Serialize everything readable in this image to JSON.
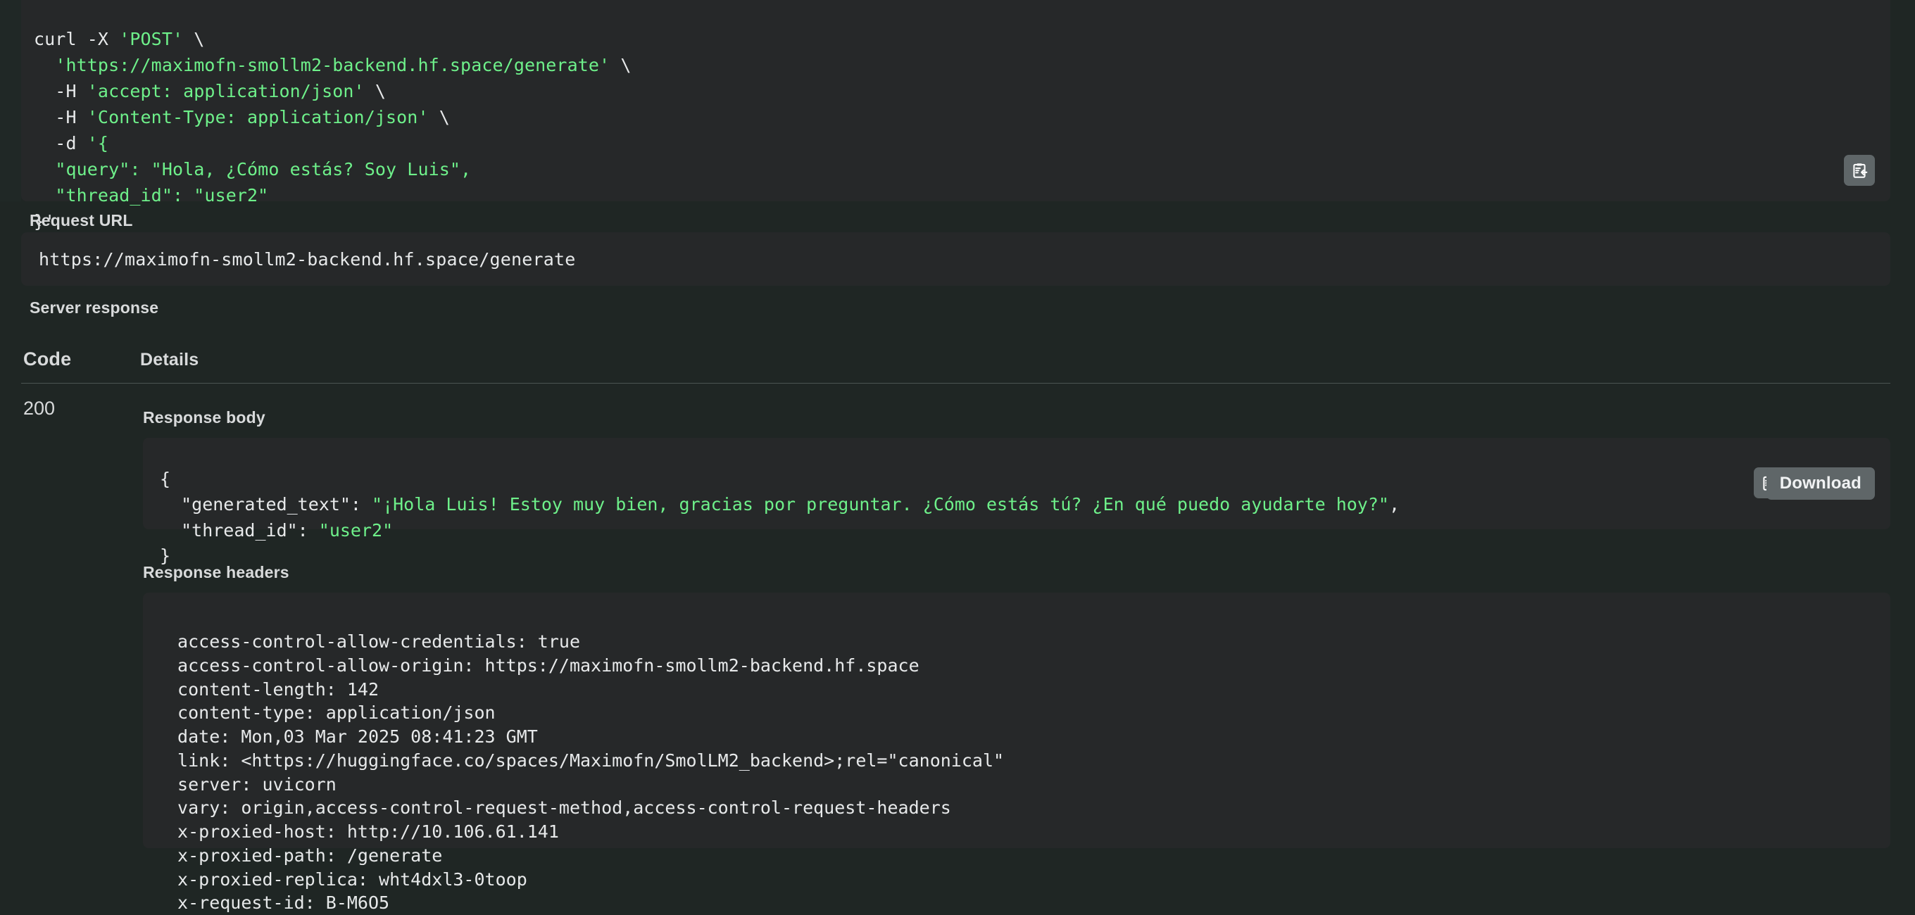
{
  "curl": {
    "lines": [
      [
        {
          "t": "curl -X ",
          "c": "w"
        },
        {
          "t": "'POST' ",
          "c": "g"
        },
        {
          "t": "\\",
          "c": "w"
        }
      ],
      [
        {
          "t": "  ",
          "c": "w"
        },
        {
          "t": "'https://maximofn-smollm2-backend.hf.space/generate' ",
          "c": "g"
        },
        {
          "t": "\\",
          "c": "w"
        }
      ],
      [
        {
          "t": "  -H ",
          "c": "w"
        },
        {
          "t": "'accept: application/json' ",
          "c": "g"
        },
        {
          "t": "\\",
          "c": "w"
        }
      ],
      [
        {
          "t": "  -H ",
          "c": "w"
        },
        {
          "t": "'Content-Type: application/json' ",
          "c": "g"
        },
        {
          "t": "\\",
          "c": "w"
        }
      ],
      [
        {
          "t": "  -d ",
          "c": "w"
        },
        {
          "t": "'{",
          "c": "g"
        }
      ],
      [
        {
          "t": "  ",
          "c": "g"
        },
        {
          "t": "\"query\": \"Hola, ¿Cómo estás? Soy Luis\",",
          "c": "g"
        }
      ],
      [
        {
          "t": "  ",
          "c": "g"
        },
        {
          "t": "\"thread_id\": \"user2\"",
          "c": "g"
        }
      ],
      [
        {
          "t": "}'",
          "c": "w"
        }
      ]
    ],
    "copy_title": "Copy to clipboard"
  },
  "request_url": {
    "label": "Request URL",
    "value": "https://maximofn-smollm2-backend.hf.space/generate"
  },
  "server_response": {
    "label": "Server response",
    "columns": {
      "code": "Code",
      "details": "Details"
    },
    "row": {
      "code": "200",
      "response_body_label": "Response body",
      "response_headers_label": "Response headers",
      "download_label": "Download",
      "copy_title": "Copy to clipboard"
    }
  },
  "response_body": {
    "lines": [
      [
        {
          "t": "{",
          "c": "w"
        }
      ],
      [
        {
          "t": "  \"generated_text\": ",
          "c": "w"
        },
        {
          "t": "\"¡Hola Luis! Estoy muy bien, gracias por preguntar. ¿Cómo estás tú? ¿En qué puedo ayudarte hoy?\"",
          "c": "g"
        },
        {
          "t": ",",
          "c": "w"
        }
      ],
      [
        {
          "t": "  \"thread_id\": ",
          "c": "w"
        },
        {
          "t": "\"user2\"",
          "c": "g"
        }
      ],
      [
        {
          "t": "}",
          "c": "w"
        }
      ]
    ]
  },
  "response_headers": {
    "lines": [
      " access-control-allow-credentials: true ",
      " access-control-allow-origin: https://maximofn-smollm2-backend.hf.space ",
      " content-length: 142 ",
      " content-type: application/json ",
      " date: Mon,03 Mar 2025 08:41:23 GMT ",
      " link: <https://huggingface.co/spaces/Maximofn/SmolLM2_backend>;rel=\"canonical\" ",
      " server: uvicorn ",
      " vary: origin,access-control-request-method,access-control-request-headers ",
      " x-proxied-host: http://10.106.61.141 ",
      " x-proxied-path: /generate ",
      " x-proxied-replica: wht4dxl3-0toop ",
      " x-request-id: B-M6O5 "
    ]
  },
  "colors": {
    "page_bg": "#1f2624",
    "block_bg": "#262829",
    "string_green": "#6ef08a",
    "text_light": "#e7e9ea",
    "button_gray": "#5f6668",
    "divider": "#4c5452"
  }
}
